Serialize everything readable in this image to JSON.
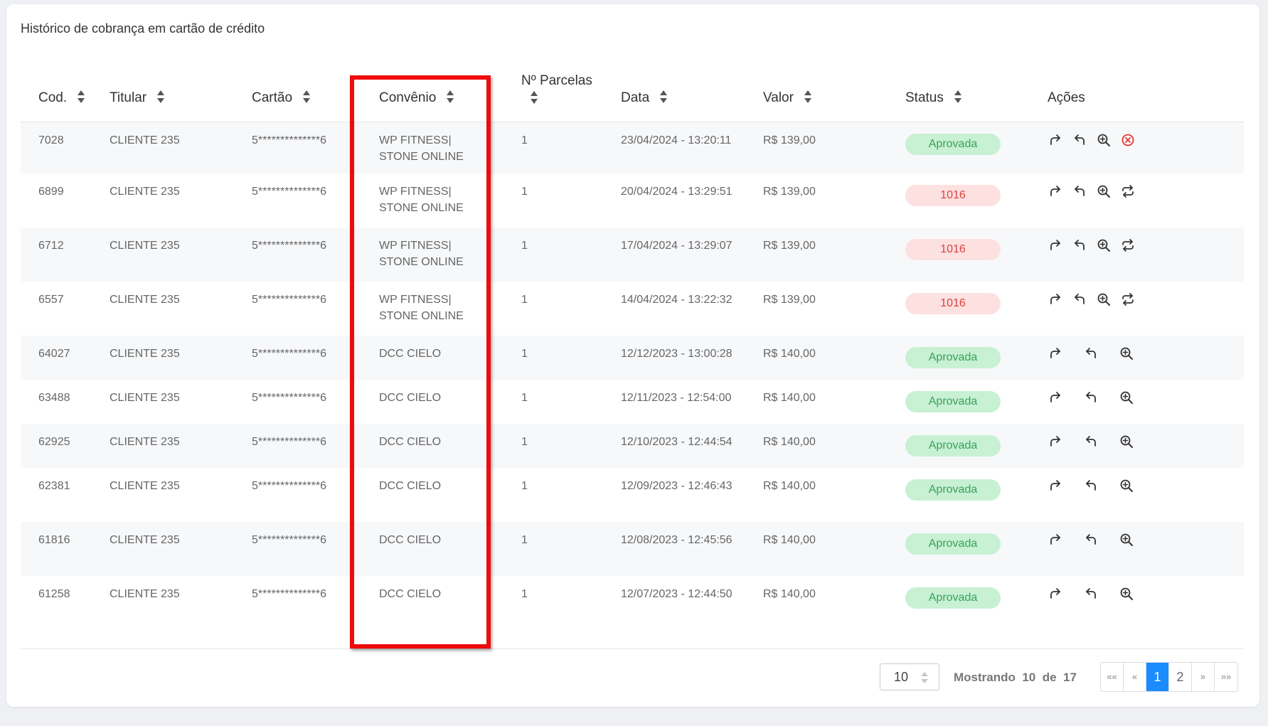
{
  "title": "Histórico de cobrança em cartão de crédito",
  "columns": {
    "cod": "Cod.",
    "titular": "Titular",
    "cartao": "Cartão",
    "convenio": "Convênio",
    "parcelas": "Nº Parcelas",
    "data": "Data",
    "valor": "Valor",
    "status": "Status",
    "acoes": "Ações"
  },
  "rows": [
    {
      "cod": "7028",
      "titular": "CLIENTE 235",
      "cartao": "5**************6",
      "convenio": "WP FITNESS| STONE ONLINE",
      "parcelas": "1",
      "data": "23/04/2024 - 13:20:11",
      "valor": "R$ 139,00",
      "status": "Aprovada",
      "status_type": "ok",
      "actions": [
        "forward-icon",
        "undo-icon",
        "zoom-in-icon",
        "cancel-icon"
      ]
    },
    {
      "cod": "6899",
      "titular": "CLIENTE 235",
      "cartao": "5**************6",
      "convenio": "WP FITNESS| STONE ONLINE",
      "parcelas": "1",
      "data": "20/04/2024 - 13:29:51",
      "valor": "R$ 139,00",
      "status": "1016",
      "status_type": "err",
      "actions": [
        "forward-icon",
        "undo-icon",
        "zoom-in-icon",
        "retry-icon"
      ]
    },
    {
      "cod": "6712",
      "titular": "CLIENTE 235",
      "cartao": "5**************6",
      "convenio": "WP FITNESS| STONE ONLINE",
      "parcelas": "1",
      "data": "17/04/2024 - 13:29:07",
      "valor": "R$ 139,00",
      "status": "1016",
      "status_type": "err",
      "actions": [
        "forward-icon",
        "undo-icon",
        "zoom-in-icon",
        "retry-icon"
      ]
    },
    {
      "cod": "6557",
      "titular": "CLIENTE 235",
      "cartao": "5**************6",
      "convenio": "WP FITNESS| STONE ONLINE",
      "parcelas": "1",
      "data": "14/04/2024 - 13:22:32",
      "valor": "R$ 139,00",
      "status": "1016",
      "status_type": "err",
      "actions": [
        "forward-icon",
        "undo-icon",
        "zoom-in-icon",
        "retry-icon"
      ]
    },
    {
      "cod": "64027",
      "titular": "CLIENTE 235",
      "cartao": "5**************6",
      "convenio": "DCC CIELO",
      "parcelas": "1",
      "data": "12/12/2023 - 13:00:28",
      "valor": "R$ 140,00",
      "status": "Aprovada",
      "status_type": "ok",
      "actions": [
        "forward-icon",
        "undo-icon",
        "zoom-in-icon"
      ]
    },
    {
      "cod": "63488",
      "titular": "CLIENTE 235",
      "cartao": "5**************6",
      "convenio": "DCC CIELO",
      "parcelas": "1",
      "data": "12/11/2023 - 12:54:00",
      "valor": "R$ 140,00",
      "status": "Aprovada",
      "status_type": "ok",
      "actions": [
        "forward-icon",
        "undo-icon",
        "zoom-in-icon"
      ]
    },
    {
      "cod": "62925",
      "titular": "CLIENTE 235",
      "cartao": "5**************6",
      "convenio": "DCC CIELO",
      "parcelas": "1",
      "data": "12/10/2023 - 12:44:54",
      "valor": "R$ 140,00",
      "status": "Aprovada",
      "status_type": "ok",
      "actions": [
        "forward-icon",
        "undo-icon",
        "zoom-in-icon"
      ]
    },
    {
      "cod": "62381",
      "titular": "CLIENTE 235",
      "cartao": "5**************6",
      "convenio": "DCC CIELO",
      "parcelas": "1",
      "data": "12/09/2023 - 12:46:43",
      "valor": "R$ 140,00",
      "status": "Aprovada",
      "status_type": "ok",
      "actions": [
        "forward-icon",
        "undo-icon",
        "zoom-in-icon"
      ]
    },
    {
      "cod": "61816",
      "titular": "CLIENTE 235",
      "cartao": "5**************6",
      "convenio": "DCC CIELO",
      "parcelas": "1",
      "data": "12/08/2023 - 12:45:56",
      "valor": "R$ 140,00",
      "status": "Aprovada",
      "status_type": "ok",
      "actions": [
        "forward-icon",
        "undo-icon",
        "zoom-in-icon"
      ]
    },
    {
      "cod": "61258",
      "titular": "CLIENTE 235",
      "cartao": "5**************6",
      "convenio": "DCC CIELO",
      "parcelas": "1",
      "data": "12/07/2023 - 12:44:50",
      "valor": "R$ 140,00",
      "status": "Aprovada",
      "status_type": "ok",
      "actions": [
        "forward-icon",
        "undo-icon",
        "zoom-in-icon"
      ]
    }
  ],
  "footer": {
    "page_size": "10",
    "showing_label": "Mostrando",
    "showing_from": "10",
    "of_label": "de",
    "total": "17",
    "pager": [
      "««",
      "«",
      "1",
      "2",
      "»",
      "»»"
    ],
    "active_page": "1"
  },
  "colors": {
    "highlight": "#ee0b0b",
    "approved_bg": "#c8f0d3",
    "approved_text": "#36a35a",
    "error_bg": "#fde0e0",
    "error_text": "#d9433f",
    "pager_active": "#1a8cff"
  }
}
